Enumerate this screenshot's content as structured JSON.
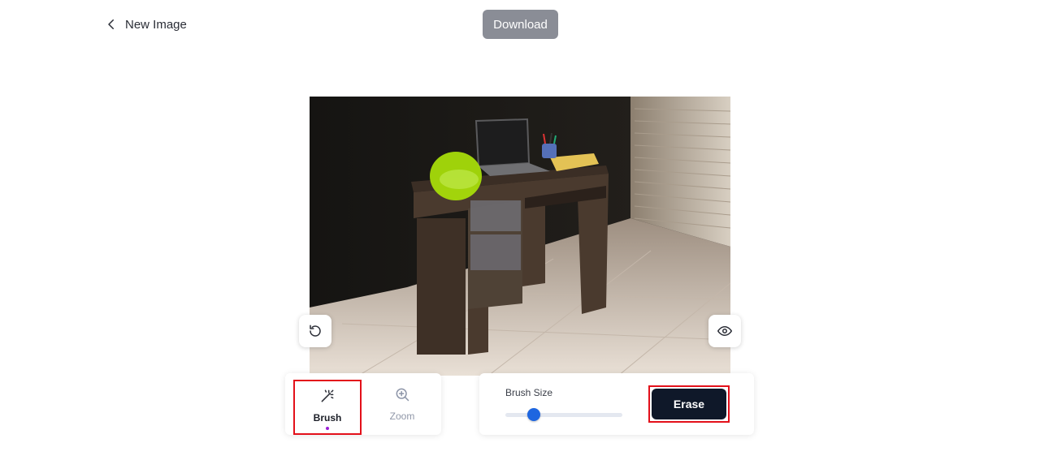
{
  "header": {
    "back_label": "New Image",
    "download_label": "Download"
  },
  "editor": {
    "undo_icon": "rotate-ccw-icon",
    "preview_icon": "eye-icon"
  },
  "tools": {
    "items": [
      {
        "label": "Brush",
        "icon": "magic-wand-icon",
        "active": true
      },
      {
        "label": "Zoom",
        "icon": "zoom-in-icon",
        "active": false
      }
    ]
  },
  "settings": {
    "brush_size_label": "Brush Size",
    "brush_size_fraction": 0.24,
    "erase_label": "Erase"
  },
  "colors": {
    "accent_dark": "#0f1829",
    "slider_knob": "#1e66e0",
    "highlight_border": "#e3101a",
    "active_dot": "#9b1fd6",
    "brush_mask": "#a6dc0a"
  }
}
